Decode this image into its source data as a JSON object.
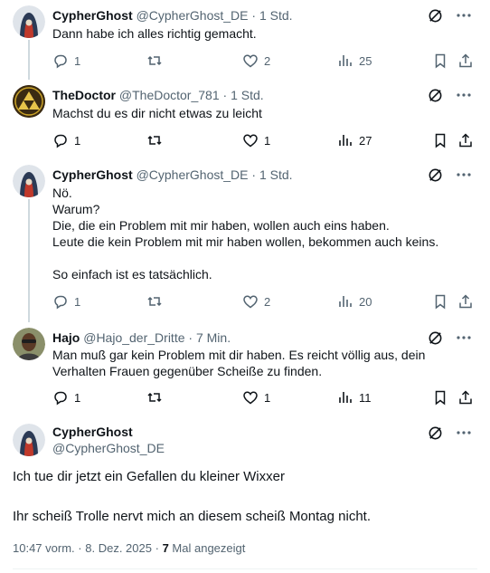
{
  "replies": [
    {
      "name": "CypherGhost",
      "handle": "@CypherGhost_DE",
      "time": "1 Std.",
      "text": "Dann habe ich alles richtig gemacht.",
      "replies": "1",
      "reposts": "",
      "likes": "2",
      "views": "25",
      "avatar_icon": "hooded-figure-avatar"
    },
    {
      "name": "TheDoctor",
      "handle": "@TheDoctor_781",
      "time": "1 Std.",
      "text": "Machst du es dir nicht etwas zu leicht",
      "replies": "1",
      "reposts": "",
      "likes": "1",
      "views": "27",
      "avatar_icon": "triforce-avatar"
    },
    {
      "name": "CypherGhost",
      "handle": "@CypherGhost_DE",
      "time": "1 Std.",
      "text": "Nö.\nWarum?\nDie, die ein Problem mit mir haben, wollen auch eins haben.\nLeute die kein Problem mit mir haben wollen, bekommen auch keins.\n\nSo einfach ist es tatsächlich.",
      "replies": "1",
      "reposts": "",
      "likes": "2",
      "views": "20",
      "avatar_icon": "hooded-figure-avatar"
    },
    {
      "name": "Hajo",
      "handle": "@Hajo_der_Dritte",
      "time": "7 Min.",
      "text": "Man muß gar kein Problem mit dir haben. Es reicht völlig aus, dein Verhalten Frauen gegenüber Scheiße zu finden.",
      "replies": "1",
      "reposts": "",
      "likes": "1",
      "views": "11",
      "avatar_icon": "person-avatar"
    }
  ],
  "main_post": {
    "name": "CypherGhost",
    "handle": "@CypherGhost_DE",
    "line1": "Ich tue dir jetzt ein Gefallen du kleiner Wixxer",
    "line2": "Ihr scheiß Trolle nervt mich an diesem scheiß Montag nicht.",
    "time": "10:47 vorm.",
    "date": "8. Dez. 2025",
    "views_count": "7",
    "views_label": "Mal angezeigt"
  },
  "separator": "·",
  "colors": {
    "text": "#0f1419",
    "secondary": "#536471",
    "thread_line": "#cfd9de",
    "divider": "#eff3f4"
  }
}
